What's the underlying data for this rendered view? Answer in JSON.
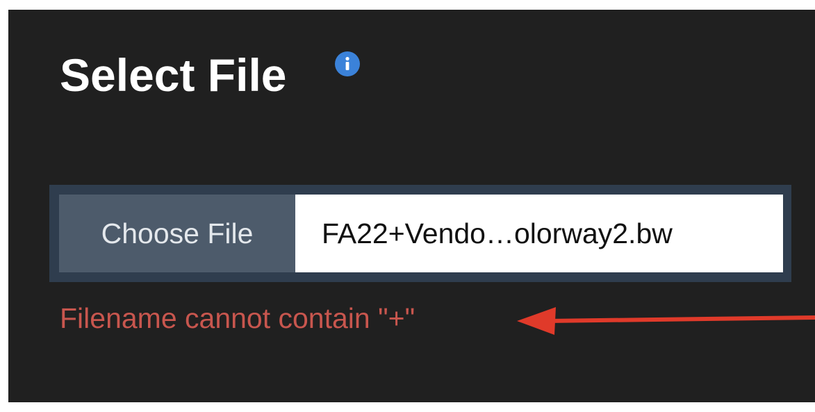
{
  "dialog": {
    "title": "Select File",
    "info_icon": "info-icon"
  },
  "file_picker": {
    "button_label": "Choose File",
    "file_name": "FA22+Vendo…olorway2.bw"
  },
  "validation": {
    "error_message": "Filename cannot contain \"+\""
  },
  "annotation": {
    "icon": "arrow-left-icon"
  },
  "colors": {
    "background": "#202020",
    "title": "#ffffff",
    "info": "#3b82d9",
    "picker_border": "#2f3d4e",
    "button_bg": "#4d5b6b",
    "error": "#c8564e",
    "annotation": "#e03a2a"
  }
}
